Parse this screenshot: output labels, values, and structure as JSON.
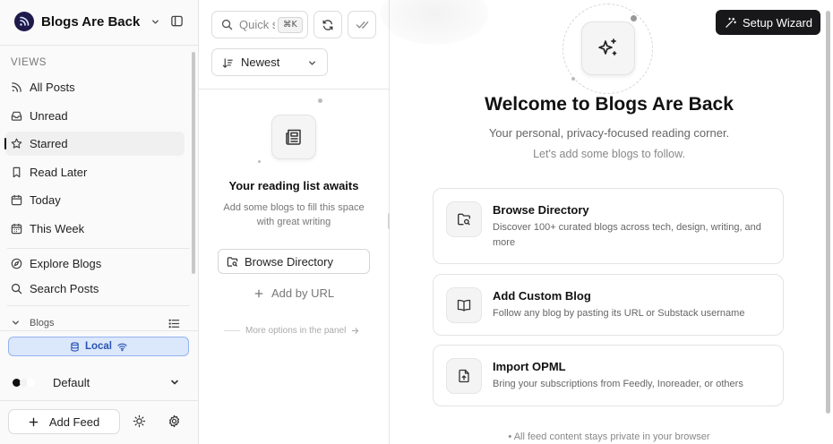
{
  "sidebar": {
    "brand": "Blogs Are Back",
    "views_label": "VIEWS",
    "items": [
      {
        "label": "All Posts",
        "icon": "rss-icon"
      },
      {
        "label": "Unread",
        "icon": "inbox-icon"
      },
      {
        "label": "Starred",
        "icon": "star-icon",
        "active": true
      },
      {
        "label": "Read Later",
        "icon": "bookmark-icon"
      },
      {
        "label": "Today",
        "icon": "calendar-icon"
      },
      {
        "label": "This Week",
        "icon": "calendar-week-icon"
      },
      {
        "label": "Explore Blogs",
        "icon": "compass-icon"
      },
      {
        "label": "Search Posts",
        "icon": "search-icon"
      }
    ],
    "blogs_label": "Blogs",
    "local_label": "Local",
    "theme_label": "Default",
    "add_feed_label": "Add Feed"
  },
  "middle": {
    "search_placeholder": "Quick search",
    "search_kbd": "⌘K",
    "sort_label": "Newest",
    "empty_title": "Your reading list awaits",
    "empty_sub": "Add some blogs to fill this space with great writing",
    "browse_label": "Browse Directory",
    "add_url_label": "Add by URL",
    "more_options": "More options in the panel"
  },
  "main": {
    "setup_label": "Setup Wizard",
    "title": "Welcome to Blogs Are Back",
    "subtitle": "Your personal, privacy-focused reading corner.",
    "subtitle2": "Let's add some blogs to follow.",
    "cards": [
      {
        "title": "Browse Directory",
        "desc": "Discover 100+ curated blogs across tech, design, writing, and more"
      },
      {
        "title": "Add Custom Blog",
        "desc": "Follow any blog by pasting its URL or Substack username"
      },
      {
        "title": "Import OPML",
        "desc": "Bring your subscriptions from Feedly, Inoreader, or others"
      }
    ],
    "privacy": "• All feed content stays private in your browser"
  },
  "colors": {
    "accent": "#18181b",
    "local_badge_bg": "#dbe7fb",
    "local_badge_text": "#2952b3"
  }
}
